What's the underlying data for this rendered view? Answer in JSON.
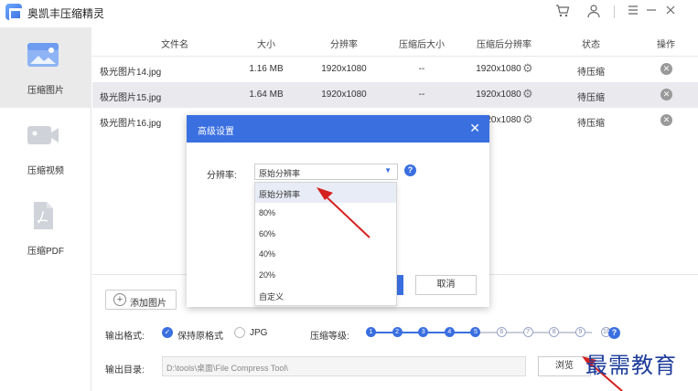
{
  "app": {
    "title": "奥凯丰压缩精灵"
  },
  "titlebar_icons": [
    "cart-icon",
    "user-icon",
    "menu-icon",
    "minimize-icon",
    "close-icon"
  ],
  "sidebar": {
    "items": [
      {
        "label": "压缩图片",
        "icon": "image-icon",
        "active": true
      },
      {
        "label": "压缩视频",
        "icon": "video-icon",
        "active": false
      },
      {
        "label": "压缩PDF",
        "icon": "pdf-icon",
        "active": false
      }
    ]
  },
  "table": {
    "headers": [
      "文件名",
      "大小",
      "分辨率",
      "压缩后大小",
      "压缩后分辨率",
      "状态",
      "操作"
    ],
    "rows": [
      {
        "name": "极光图片14.jpg",
        "size": "1.16 MB",
        "res": "1920x1080",
        "csize": "--",
        "cres": "1920x1080",
        "status": "待压缩"
      },
      {
        "name": "极光图片15.jpg",
        "size": "1.64 MB",
        "res": "1920x1080",
        "csize": "--",
        "cres": "1920x1080",
        "status": "待压缩"
      },
      {
        "name": "极光图片16.jpg",
        "size": "",
        "res": "",
        "csize": "",
        "cres": "1920x1080",
        "status": "待压缩"
      }
    ]
  },
  "bottom": {
    "add_label": "添加图片",
    "format_label": "输出格式:",
    "format_keep": "保持原格式",
    "format_jpg": "JPG",
    "level_label": "压缩等级:",
    "levels": [
      "1",
      "2",
      "3",
      "4",
      "5",
      "6",
      "7",
      "8",
      "9",
      "10"
    ],
    "level_selected": 5,
    "dir_label": "输出目录:",
    "dir_value": "D:\\tools\\桌面\\File Compress Tool\\",
    "browse_label": "浏览"
  },
  "modal": {
    "title": "高级设置",
    "res_label": "分辨率:",
    "selected": "原始分辨率",
    "options": [
      "原始分辨率",
      "80%",
      "60%",
      "40%",
      "20%",
      "自定义"
    ],
    "cancel_label": "取消"
  },
  "watermark": "最需教育",
  "colors": {
    "accent": "#3a6fe0",
    "arrow": "#d42020"
  }
}
